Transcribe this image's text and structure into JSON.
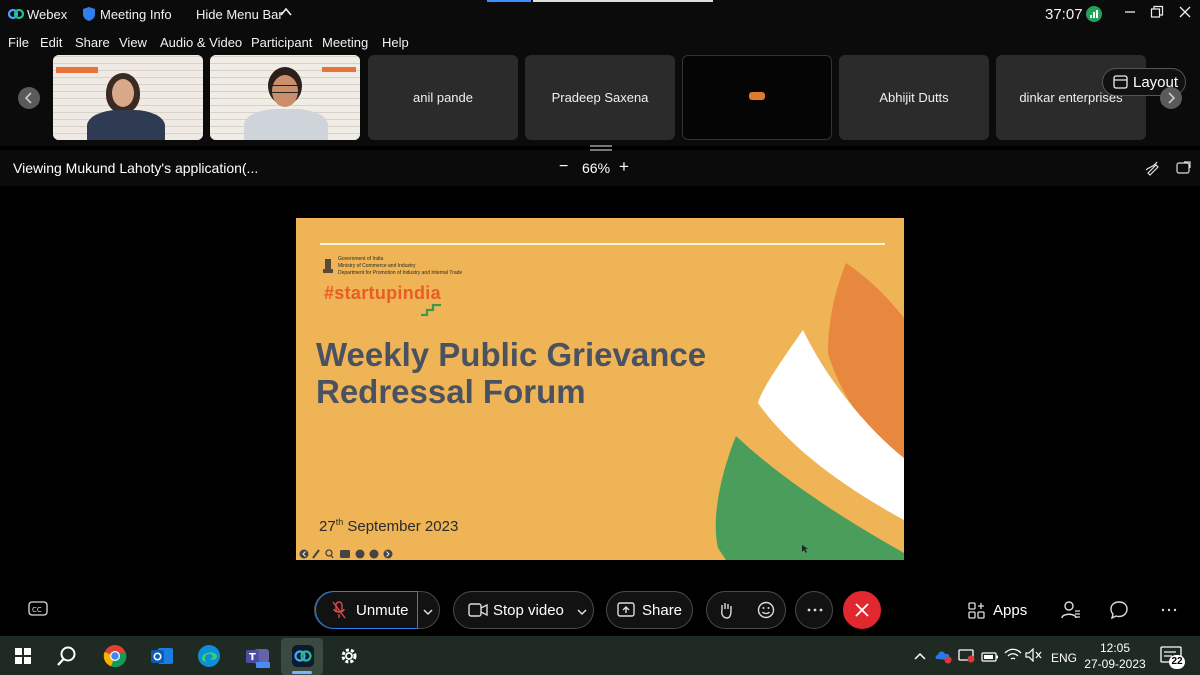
{
  "titlebar": {
    "app_name": "Webex",
    "meeting_info": "Meeting Info",
    "hide_menu_bar": "Hide Menu Bar",
    "timer": "37:07"
  },
  "menu": [
    "File",
    "Edit",
    "Share",
    "View",
    "Audio & Video",
    "Participant",
    "Meeting",
    "Help"
  ],
  "participants": [
    {
      "name": ""
    },
    {
      "name": ""
    },
    {
      "name": "anil pande"
    },
    {
      "name": "Pradeep Saxena"
    },
    {
      "name": ""
    },
    {
      "name": "Abhijit Dutts"
    },
    {
      "name": "dinkar enterprises"
    }
  ],
  "layout_label": "Layout",
  "viewing": {
    "label": "Viewing Mukund Lahoty's application(...",
    "zoom": "66%",
    "zoom_minus": "−",
    "zoom_plus": "+"
  },
  "slide": {
    "gov_line1": "Government of India",
    "gov_line2": "Ministry of Commerce and Industry",
    "gov_line3": "Department for Promotion of Industry and Internal Trade",
    "brand": "#startupindia",
    "title_line1": "Weekly Public Grievance",
    "title_line2": "Redressal Forum",
    "date_day": "27",
    "date_suffix": "th",
    "date_rest": " September 2023"
  },
  "controls": {
    "unmute": "Unmute",
    "stop_video": "Stop video",
    "share": "Share",
    "apps": "Apps"
  },
  "taskbar": {
    "time": "12:05",
    "date": "27-09-2023",
    "lang": "ENG",
    "notifications": "22"
  },
  "colors": {
    "slide_bg": "#eeb455",
    "slide_title": "#4a5160",
    "brand_orange": "#e85d26",
    "saffron": "#e8873e",
    "green": "#4a9d5a",
    "end_red": "#e0282e",
    "webex_blue": "#1f6ff0"
  }
}
